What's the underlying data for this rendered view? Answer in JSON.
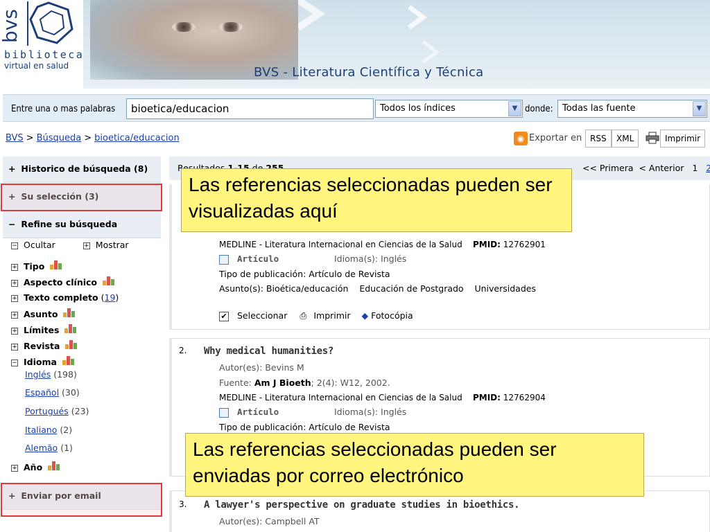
{
  "banner": {
    "logo_vertical": "bvs",
    "logo_line1": "biblioteca",
    "logo_line2": "virtual en salud",
    "title": "BVS - Literatura Científica y Técnica"
  },
  "search": {
    "label": "Entre una o mas palabras",
    "query": "bioetica/educacion",
    "index_select": "Todos los índices",
    "where_label": "donde:",
    "source_select": "Todas las fuente"
  },
  "breadcrumb": {
    "items": [
      "BVS",
      "Búsqueda",
      "bioetica/educacion"
    ],
    "separator": ">"
  },
  "export": {
    "label": "Exportar en",
    "rss": "RSS",
    "xml": "XML",
    "print": "Imprimir"
  },
  "sidebar": {
    "history": "Historico de búsqueda",
    "history_count": "(8)",
    "selection": "Su selección",
    "selection_count": "(3)",
    "refine": "Refine su búsqueda",
    "hide": "Ocultar",
    "show": "Mostrar",
    "facets": [
      {
        "label": "Tipo"
      },
      {
        "label": "Aspecto clínico"
      },
      {
        "label": "Texto completo",
        "count": "19"
      },
      {
        "label": "Asunto"
      },
      {
        "label": "Límites"
      },
      {
        "label": "Revista"
      },
      {
        "label": "Idioma"
      }
    ],
    "languages": [
      {
        "label": "Inglés",
        "count": "(198)"
      },
      {
        "label": "Español",
        "count": "(30)"
      },
      {
        "label": "Portugués",
        "count": "(23)"
      },
      {
        "label": "Italiano",
        "count": "(2)"
      },
      {
        "label": "Alemão",
        "count": "(1)"
      }
    ],
    "year": "Año",
    "email": "Enviar por email"
  },
  "results_bar": {
    "count_prefix": "Resultados",
    "count_range": "1-15",
    "count_of": "de",
    "count_total": "255",
    "first": "<< Primera",
    "prev": "< Anterior",
    "page1": "1",
    "page2": "2"
  },
  "record1": {
    "source": "MEDLINE - Literatura Internacional en Ciencias de la Salud",
    "pmid_label": "PMID:",
    "pmid": "12762901",
    "article": "Artículo",
    "language": "Idioma(s): Inglés",
    "pubtype": "Tipo de publicación: Artículo de Revista",
    "subjects_label": "Asunto(s):",
    "subjects": [
      "Bioética/educación",
      "Educación de Postgrado",
      "Universidades"
    ],
    "select": "Seleccionar",
    "print": "Imprimir",
    "photocopy": "Fotocópia"
  },
  "record2": {
    "num": "2.",
    "title": "Why medical humanities?",
    "authors": "Autor(es): Bevins M",
    "source_label": "Fuente:",
    "journal": "Am J Bioeth",
    "citation": "; 2(4): W12, 2002.",
    "database": "MEDLINE - Literatura Internacional en Ciencias de la Salud",
    "pmid_label": "PMID:",
    "pmid": "12762904",
    "article": "Artículo",
    "language": "Idioma(s): Inglés",
    "pubtype": "Tipo de publicación: Artículo de Revista"
  },
  "record3": {
    "num": "3.",
    "title": "A lawyer's perspective on graduate studies in bioethics.",
    "authors": "Autor(es): Campbell AT"
  },
  "callouts": {
    "top": "Las referencias seleccionadas pueden ser visualizadas aquí",
    "bottom": "Las referencias seleccionadas  pueden ser enviadas por correo electrónico"
  },
  "colors": {
    "link": "#1a3fa8",
    "highlight_border": "#e23a3a",
    "callout_bg": "#fff57f",
    "brand_blue": "#1c3f78"
  }
}
